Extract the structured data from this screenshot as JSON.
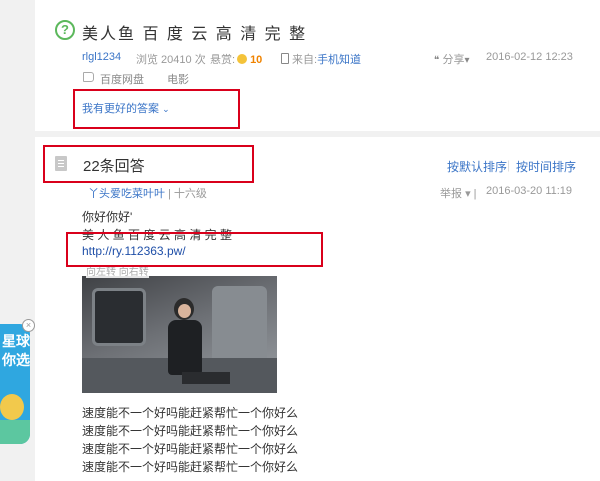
{
  "question": {
    "title": "美人鱼 百 度 云 高 清 完 整",
    "author": "rlgl1234",
    "views": "浏览 20410 次",
    "bounty_label": "悬赏:",
    "bounty_value": "10",
    "source_label": "来自:",
    "source_value": "手机知道",
    "share": "分享",
    "date": "2016-02-12 12:23",
    "tags": [
      "百度网盘",
      "电影"
    ],
    "better_answer": "我有更好的答案"
  },
  "answers": {
    "count_title": "22条回答",
    "sort_default": "按默认排序",
    "sort_time": "按时间排序",
    "answerer": "丫头爱吃菜叶叶",
    "level": "十六级",
    "report": "举报",
    "date": "2016-03-20 11:19",
    "line1": "你好你好'",
    "line2": "美 人 鱼 百 度 云 高 清 完 整",
    "url": "http://ry.112363.pw/",
    "img_tools": "向左转   向右转",
    "repeat_line": "速度能不一个好吗能赶紧帮忙一个你好么"
  },
  "side_widget": {
    "text": "星球\n你选!"
  },
  "colors": {
    "link": "#3b75c7",
    "accent_green": "#5cb85c",
    "highlight_red": "#d9001b"
  },
  "icons": [
    "question-icon",
    "tag-icon",
    "coin-icon",
    "phone-icon",
    "share-icon",
    "chevron-down-icon",
    "document-icon",
    "dropdown-icon",
    "close-icon"
  ]
}
